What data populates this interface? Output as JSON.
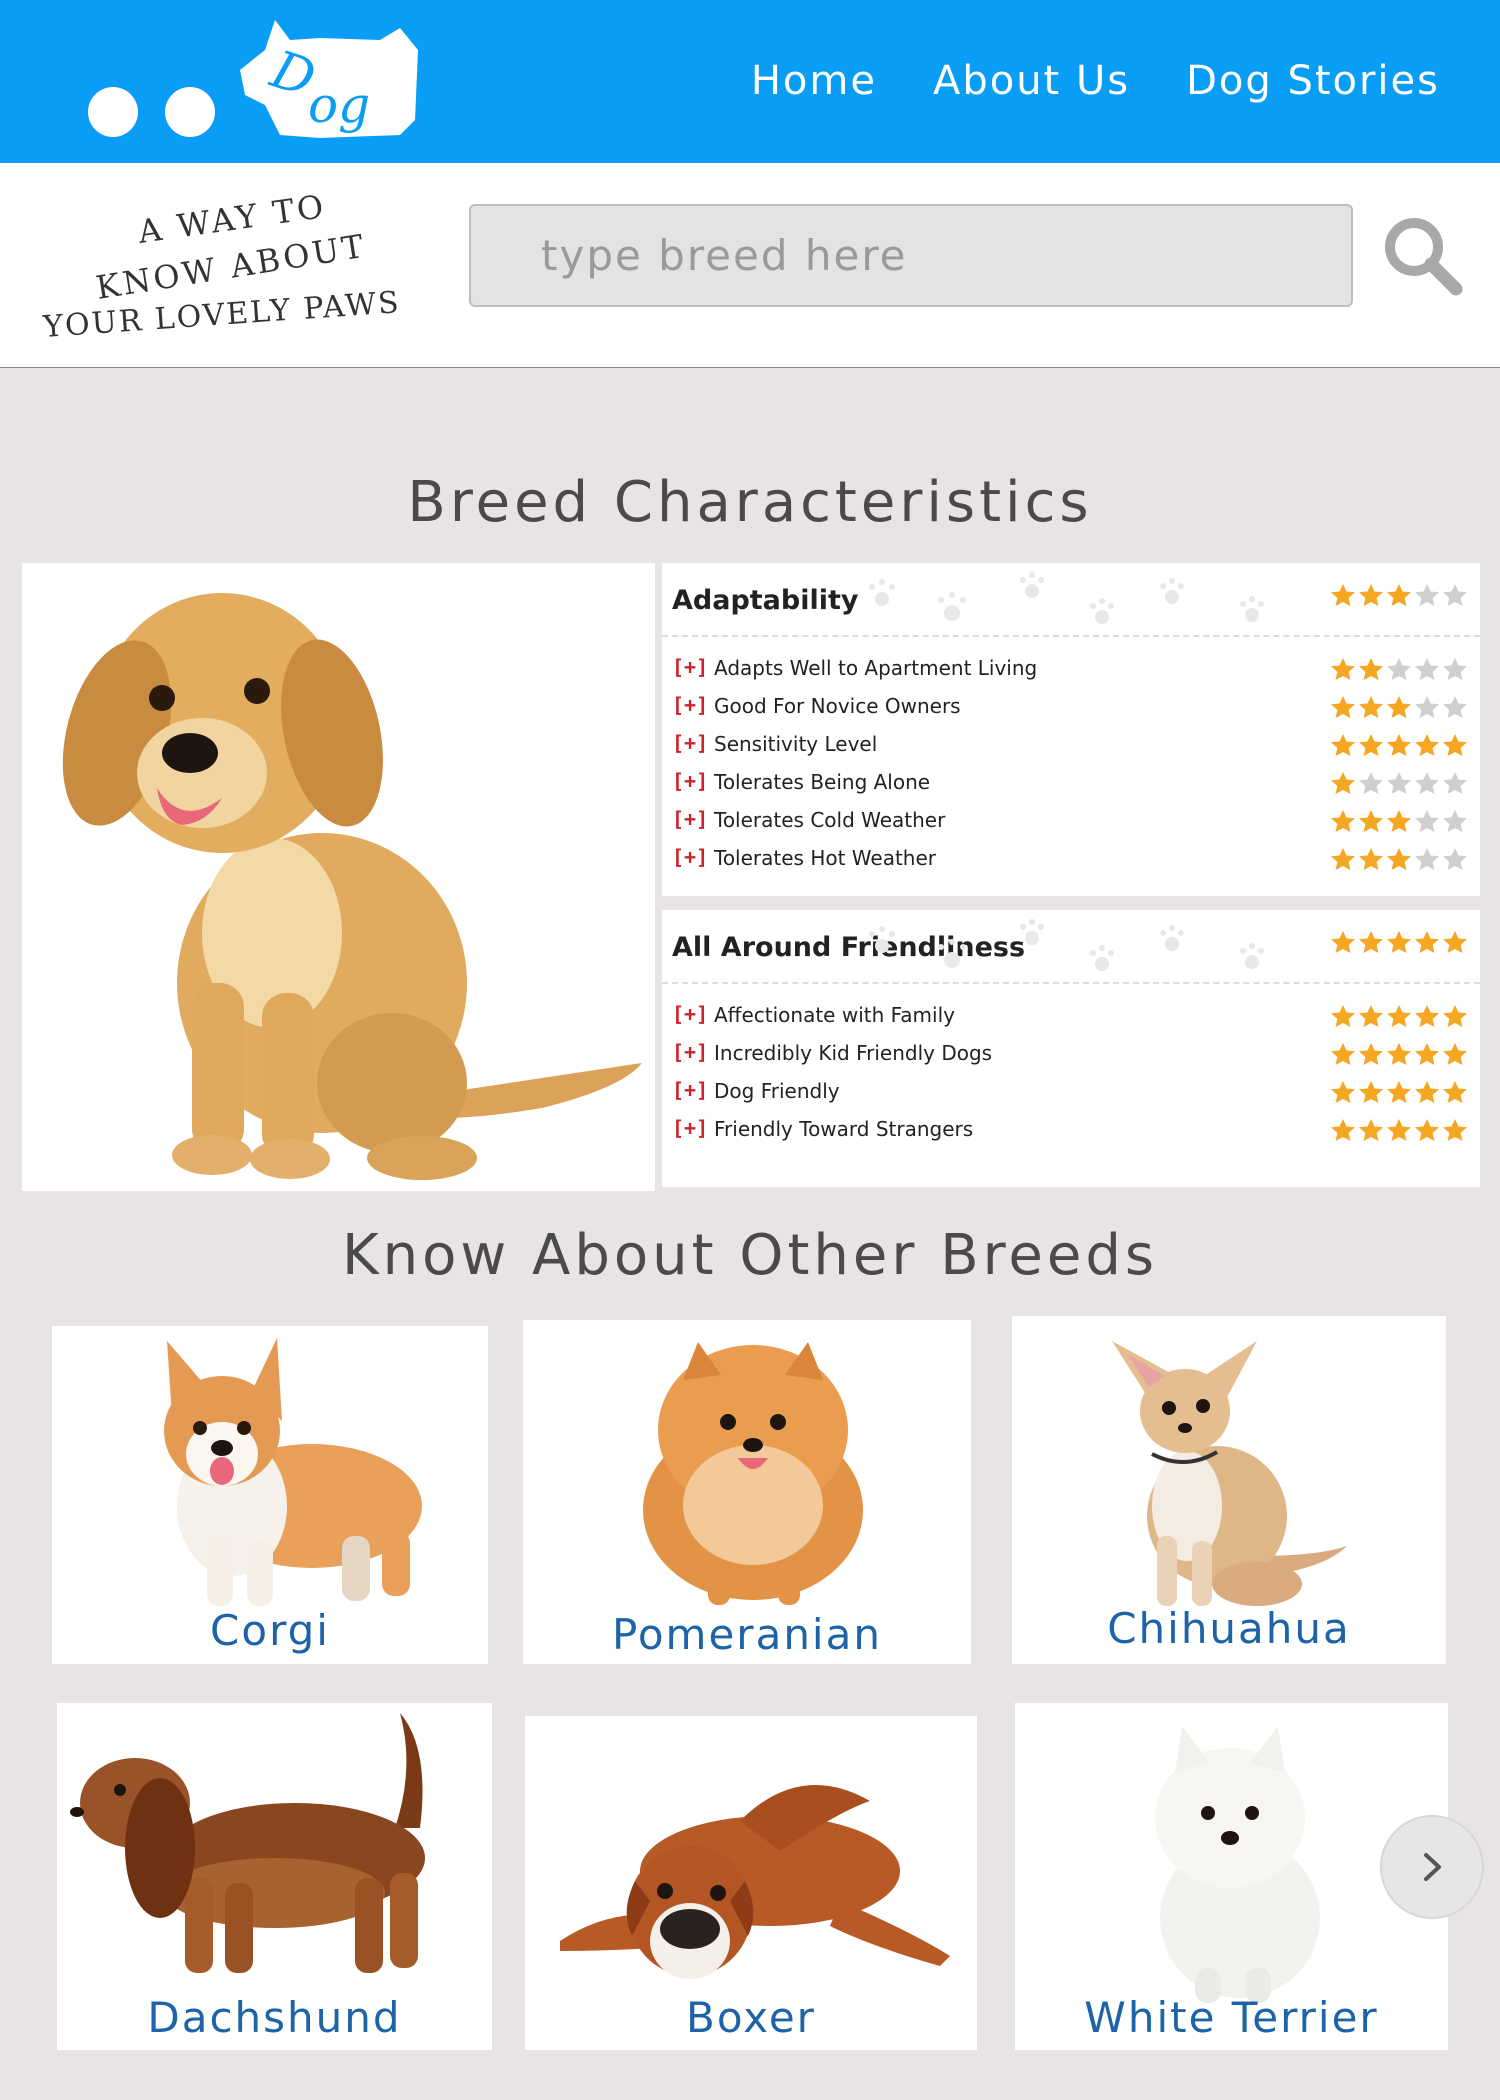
{
  "header": {
    "logo_text": "Dog",
    "nav": [
      "Home",
      "About Us",
      "Dog Stories"
    ]
  },
  "tagline": {
    "line1": "A WAY TO",
    "line2": "KNOW ABOUT",
    "line3": "YOUR LOVELY PAWS"
  },
  "search": {
    "placeholder": "type breed here",
    "icon": "search-icon"
  },
  "characteristics": {
    "title": "Breed Characteristics",
    "groups": [
      {
        "name": "Adaptability",
        "rating": 3,
        "items": [
          {
            "label": "Adapts Well to Apartment Living",
            "rating": 2
          },
          {
            "label": "Good For Novice Owners",
            "rating": 3
          },
          {
            "label": "Sensitivity Level",
            "rating": 5
          },
          {
            "label": "Tolerates Being Alone",
            "rating": 1
          },
          {
            "label": "Tolerates Cold Weather",
            "rating": 3
          },
          {
            "label": "Tolerates Hot Weather",
            "rating": 3
          }
        ]
      },
      {
        "name": "All Around Friendliness",
        "rating": 5,
        "items": [
          {
            "label": "Affectionate with Family",
            "rating": 5
          },
          {
            "label": "Incredibly Kid Friendly Dogs",
            "rating": 5
          },
          {
            "label": "Dog Friendly",
            "rating": 5
          },
          {
            "label": "Friendly Toward Strangers",
            "rating": 5
          }
        ]
      }
    ],
    "expand_marker": "[+]",
    "star_color": "#f5a623",
    "star_empty_color": "#cfcfcf"
  },
  "other_breeds": {
    "title": "Know About Other Breeds",
    "breeds": [
      "Corgi",
      "Pomeranian",
      "Chihuahua",
      "Dachshund",
      "Boxer",
      "White Terrier"
    ],
    "next_icon": "chevron-right-icon"
  },
  "colors": {
    "header_bg": "#0a9df5",
    "breed_name": "#1d63a8"
  }
}
